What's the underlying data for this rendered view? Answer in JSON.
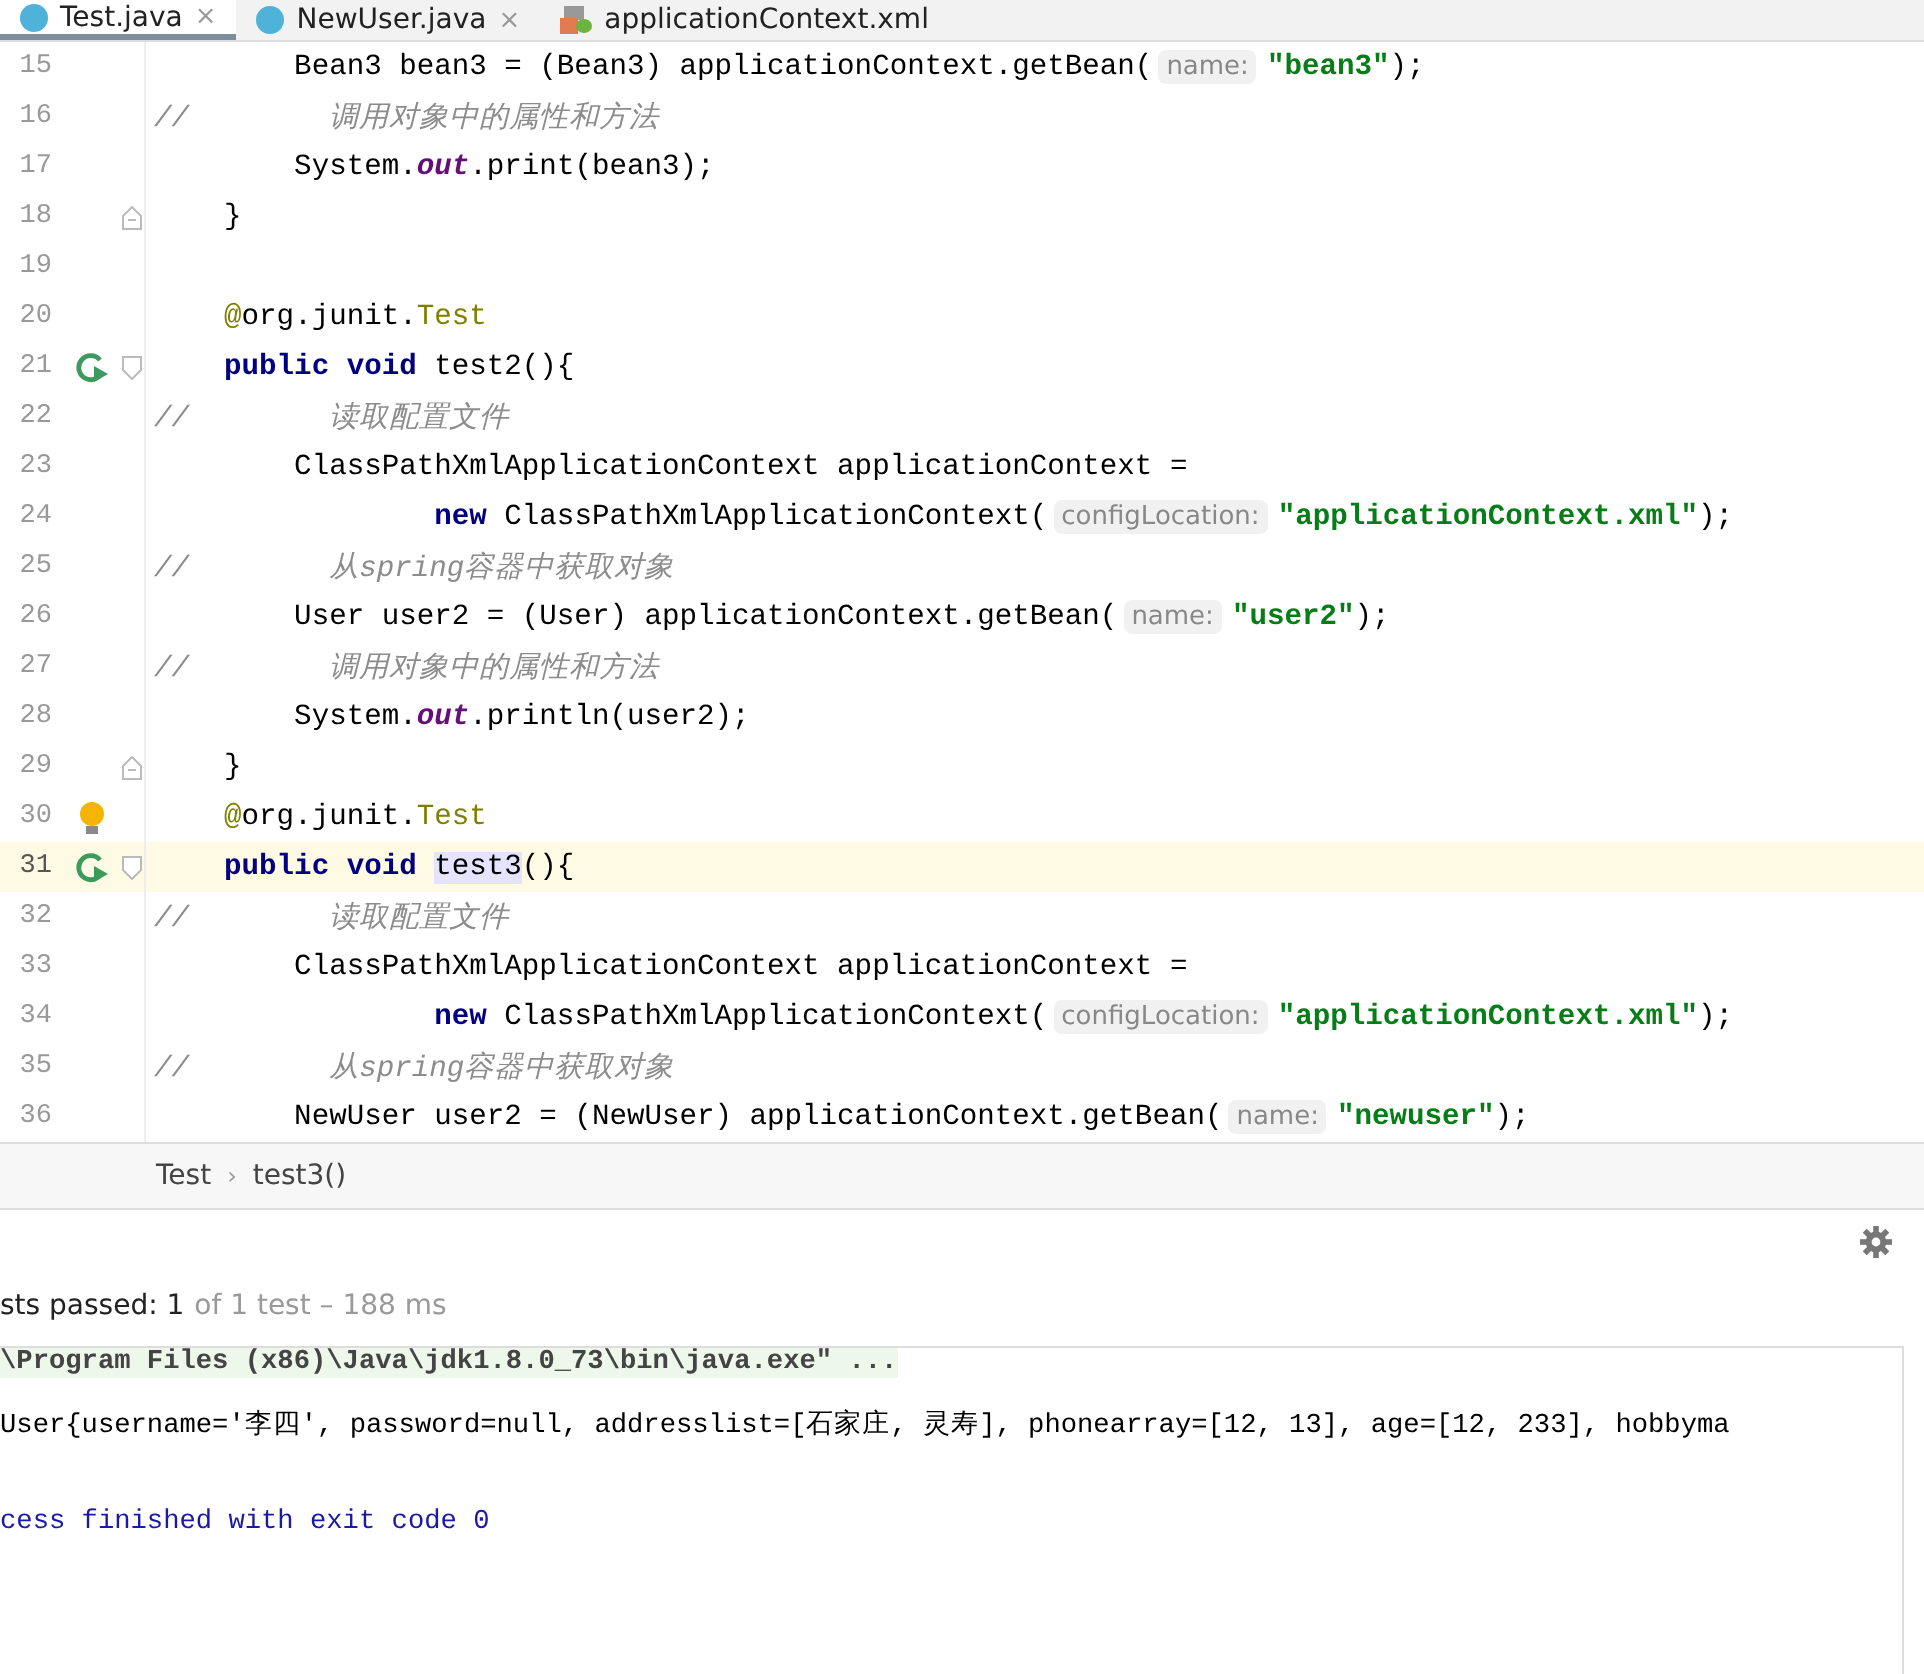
{
  "tabs": [
    {
      "label": "Test.java",
      "kind": "java",
      "close": "×",
      "selected": true
    },
    {
      "label": "NewUser.java",
      "kind": "java",
      "close": "×",
      "selected": false
    },
    {
      "label": "applicationContext.xml",
      "kind": "xml",
      "selected": false
    }
  ],
  "editor": {
    "lines": [
      {
        "number": "15",
        "current": false,
        "segments": [
          {
            "kind": "text",
            "text": "        Bean3 bean3 = (Bean3) applicationContext.getBean("
          },
          {
            "kind": "hint",
            "text": "name:"
          },
          {
            "kind": "string",
            "text": "\"bean3\""
          },
          {
            "kind": "text",
            "text": ");"
          }
        ]
      },
      {
        "number": "16",
        "current": false,
        "segments": [
          {
            "kind": "comment",
            "text": "//        调用对象中的属性和方法"
          }
        ]
      },
      {
        "number": "17",
        "current": false,
        "segments": [
          {
            "kind": "text",
            "text": "        System."
          },
          {
            "kind": "field",
            "text": "out"
          },
          {
            "kind": "text",
            "text": ".print(bean3);"
          }
        ]
      },
      {
        "number": "18",
        "current": false,
        "fold_end": true,
        "segments": [
          {
            "kind": "text",
            "text": "    }"
          }
        ]
      },
      {
        "number": "19",
        "current": false
      },
      {
        "number": "20",
        "current": false,
        "segments": [
          {
            "kind": "annot",
            "text": "    @"
          },
          {
            "kind": "text",
            "text": "org.junit."
          },
          {
            "kind": "annot",
            "text": "Test"
          }
        ]
      },
      {
        "number": "21",
        "current": false,
        "run_marker": true,
        "fold_start": true,
        "segments": [
          {
            "kind": "keyword",
            "text": "    public void"
          },
          {
            "kind": "text",
            "text": " test2(){"
          }
        ]
      },
      {
        "number": "22",
        "current": false,
        "segments": [
          {
            "kind": "comment",
            "text": "//        读取配置文件"
          }
        ]
      },
      {
        "number": "23",
        "current": false,
        "segments": [
          {
            "kind": "text",
            "text": "        ClassPathXmlApplicationContext applicationContext ="
          }
        ]
      },
      {
        "number": "24",
        "current": false,
        "segments": [
          {
            "kind": "keyword",
            "text": "                new"
          },
          {
            "kind": "text",
            "text": " ClassPathXmlApplicationContext("
          },
          {
            "kind": "hint",
            "text": "configLocation:"
          },
          {
            "kind": "string",
            "text": "\"applicationContext.xml\""
          },
          {
            "kind": "text",
            "text": ");"
          }
        ]
      },
      {
        "number": "25",
        "current": false,
        "segments": [
          {
            "kind": "comment",
            "text": "//        从spring容器中获取对象"
          }
        ]
      },
      {
        "number": "26",
        "current": false,
        "segments": [
          {
            "kind": "text",
            "text": "        User user2 = (User) applicationContext.getBean("
          },
          {
            "kind": "hint",
            "text": "name:"
          },
          {
            "kind": "string",
            "text": "\"user2\""
          },
          {
            "kind": "text",
            "text": ");"
          }
        ]
      },
      {
        "number": "27",
        "current": false,
        "segments": [
          {
            "kind": "comment",
            "text": "//        调用对象中的属性和方法"
          }
        ]
      },
      {
        "number": "28",
        "current": false,
        "segments": [
          {
            "kind": "text",
            "text": "        System."
          },
          {
            "kind": "field",
            "text": "out"
          },
          {
            "kind": "text",
            "text": ".println(user2);"
          }
        ]
      },
      {
        "number": "29",
        "current": false,
        "fold_end": true,
        "segments": [
          {
            "kind": "text",
            "text": "    }"
          }
        ]
      },
      {
        "number": "30",
        "current": false,
        "bulb": true,
        "segments": [
          {
            "kind": "annot",
            "text": "    @"
          },
          {
            "kind": "text",
            "text": "org.junit."
          },
          {
            "kind": "annot",
            "text": "Test"
          }
        ]
      },
      {
        "number": "31",
        "current": true,
        "run_marker": true,
        "fold_start": true,
        "segments": [
          {
            "kind": "keyword",
            "text": "    public void "
          },
          {
            "kind": "usage",
            "text": "test3"
          },
          {
            "kind": "text",
            "text": "(){"
          }
        ]
      },
      {
        "number": "32",
        "current": false,
        "segments": [
          {
            "kind": "comment",
            "text": "//        读取配置文件"
          }
        ]
      },
      {
        "number": "33",
        "current": false,
        "segments": [
          {
            "kind": "text",
            "text": "        ClassPathXmlApplicationContext applicationContext ="
          }
        ]
      },
      {
        "number": "34",
        "current": false,
        "segments": [
          {
            "kind": "keyword",
            "text": "                new"
          },
          {
            "kind": "text",
            "text": " ClassPathXmlApplicationContext("
          },
          {
            "kind": "hint",
            "text": "configLocation:"
          },
          {
            "kind": "string",
            "text": "\"applicationContext.xml\""
          },
          {
            "kind": "text",
            "text": ");"
          }
        ]
      },
      {
        "number": "35",
        "current": false,
        "segments": [
          {
            "kind": "comment",
            "text": "//        从spring容器中获取对象"
          }
        ]
      },
      {
        "number": "36",
        "current": false,
        "segments": [
          {
            "kind": "text",
            "text": "        NewUser user2 = (NewUser) applicationContext.getBean("
          },
          {
            "kind": "hint",
            "text": "name:"
          },
          {
            "kind": "string",
            "text": "\"newuser\""
          },
          {
            "kind": "text",
            "text": ");"
          }
        ]
      }
    ]
  },
  "breadcrumb": {
    "items": [
      "Test",
      "test3()"
    ],
    "separator": "›"
  },
  "run_panel": {
    "status": "sts passed: 1",
    "detail": "of 1 test – 188 ms",
    "console": [
      {
        "kind": "command",
        "text": "\\Program Files (x86)\\Java\\jdk1.8.0_73\\bin\\java.exe\" ..."
      },
      {
        "kind": "output",
        "text": "User{username='李四', password=null, addresslist=[石家庄, 灵寿], phonearray=[12, 13], age=[12, 233], hobbyma"
      },
      {
        "kind": "system",
        "text": "cess finished with exit code 0"
      }
    ]
  }
}
